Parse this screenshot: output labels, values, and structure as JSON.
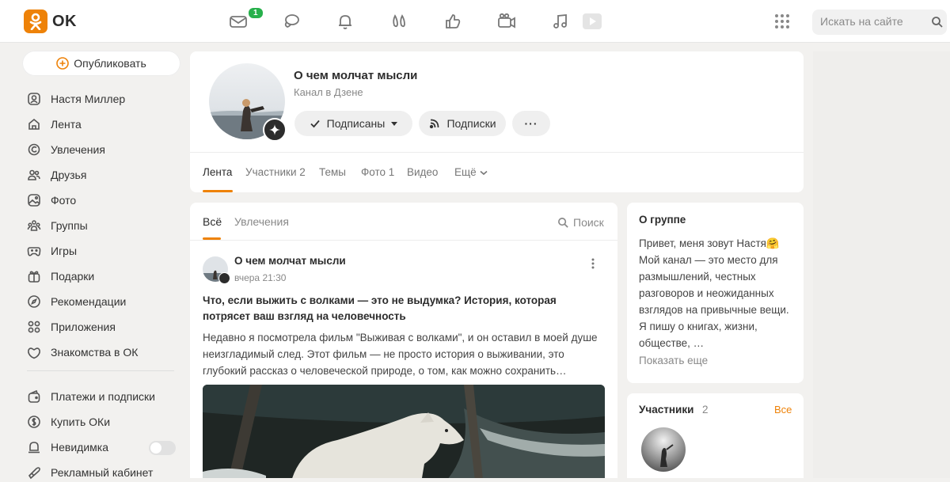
{
  "header": {
    "logo_text": "OK",
    "mail_badge": "1",
    "nav_icons": [
      "mail-icon",
      "chat-icon",
      "bell-icon",
      "guests-icon",
      "likes-icon",
      "video-icon",
      "music-icon",
      "play-icon"
    ],
    "search": {
      "placeholder": "Искать на сайте"
    }
  },
  "sidebar": {
    "publish_label": "Опубликовать",
    "items": [
      {
        "label": "Настя Миллер",
        "icon": "user-icon"
      },
      {
        "label": "Лента",
        "icon": "home-icon"
      },
      {
        "label": "Увлечения",
        "icon": "hobby-icon"
      },
      {
        "label": "Друзья",
        "icon": "friends-icon"
      },
      {
        "label": "Фото",
        "icon": "photo-icon"
      },
      {
        "label": "Группы",
        "icon": "groups-icon"
      },
      {
        "label": "Игры",
        "icon": "gamepad-icon"
      },
      {
        "label": "Подарки",
        "icon": "gift-icon"
      },
      {
        "label": "Рекомендации",
        "icon": "compass-icon"
      },
      {
        "label": "Приложения",
        "icon": "apps-icon"
      },
      {
        "label": "Знакомства в ОК",
        "icon": "dating-icon"
      }
    ],
    "items2": [
      {
        "label": "Платежи и подписки",
        "icon": "wallet-icon"
      },
      {
        "label": "Купить ОКи",
        "icon": "coin-icon"
      },
      {
        "label": "Невидимка",
        "icon": "invisible-icon"
      },
      {
        "label": "Рекламный кабинет",
        "icon": "ads-icon"
      }
    ]
  },
  "group": {
    "title": "О чем молчат мысли",
    "subtitle": "Канал в Дзене",
    "subscribed_label": "Подписаны",
    "subscriptions_label": "Подписки",
    "more_label": "···",
    "tabs": [
      {
        "label": "Лента"
      },
      {
        "label": "Участники 2"
      },
      {
        "label": "Темы"
      },
      {
        "label": "Фото 1"
      },
      {
        "label": "Видео"
      },
      {
        "label": "Ещё"
      }
    ]
  },
  "feed": {
    "tabs": [
      "Всё",
      "Увлечения"
    ],
    "search_label": "Поиск",
    "post": {
      "author": "О чем молчат мысли",
      "time": "вчера 21:30",
      "title": "Что, если выжить с волками — это не выдумка? История, которая потрясет ваш взгляд на человечность",
      "text": "Недавно я посмотрела фильм \"Выживая с волками\", и он оставил в моей душе неизгладимый след. Этот фильм — не просто история о выживании, это глубокий рассказ о человеческой природе, о том, как можно сохранить…"
    }
  },
  "about": {
    "title": "О группе",
    "text": "Привет, меня зовут Настя🤗 Мой канал — это место для размышлений, честных разговоров и неожиданных взглядов на привычные вещи. Я пишу о книгах, жизни, обществе, …",
    "more": "Показать еще"
  },
  "members": {
    "title": "Участники",
    "count": "2",
    "all": "Все"
  },
  "colors": {
    "accent": "#ee8208",
    "badge": "#27b04b"
  }
}
